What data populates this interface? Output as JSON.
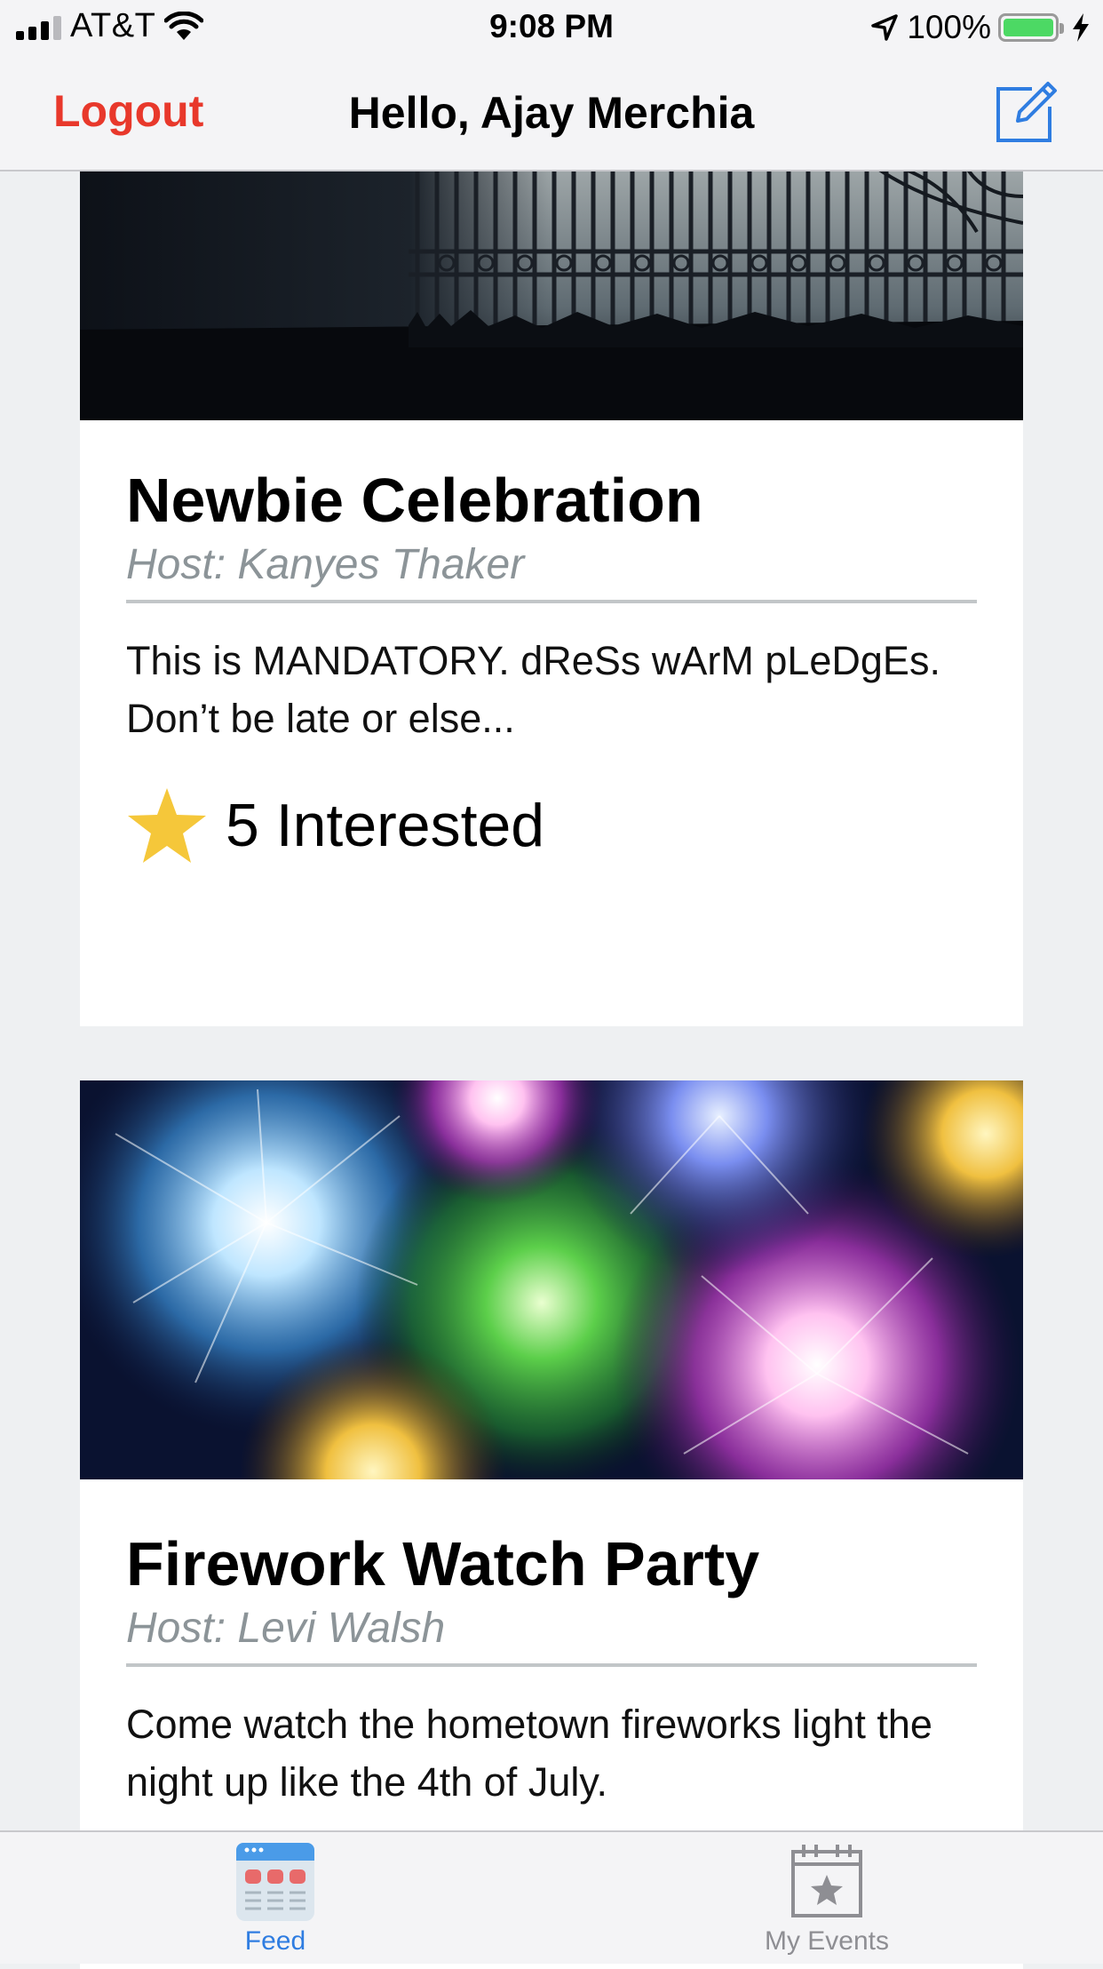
{
  "status_bar": {
    "carrier": "AT&T",
    "time": "9:08 PM",
    "battery_percent": "100%",
    "icons": [
      "signal-icon",
      "wifi-icon",
      "location-arrow-icon",
      "battery-icon",
      "charging-bolt-icon"
    ]
  },
  "navbar": {
    "logout_label": "Logout",
    "title": "Hello, Ajay Merchia",
    "compose_icon": "compose-icon"
  },
  "events": [
    {
      "title": "Newbie Celebration",
      "host": "Host: Kanyes Thaker",
      "description": "This is MANDATORY. dReSs wArM pLeDgEs. Don’t be late or else...",
      "interested": "5 Interested",
      "image": "night-iron-gate-photo"
    },
    {
      "title": "Firework Watch Party",
      "host": "Host: Levi Walsh",
      "description": "Come watch the hometown fireworks light the night up like the 4th of July.",
      "image": "fireworks-photo"
    }
  ],
  "tabbar": {
    "tabs": [
      {
        "label": "Feed",
        "icon": "feed-icon",
        "selected": true
      },
      {
        "label": "My Events",
        "icon": "calendar-star-icon",
        "selected": false
      }
    ]
  },
  "colors": {
    "accent_red": "#e8382b",
    "tab_blue": "#2f7de1",
    "star_yellow": "#f5c73a",
    "host_gray": "#8c9498",
    "background": "#eef0f2"
  }
}
